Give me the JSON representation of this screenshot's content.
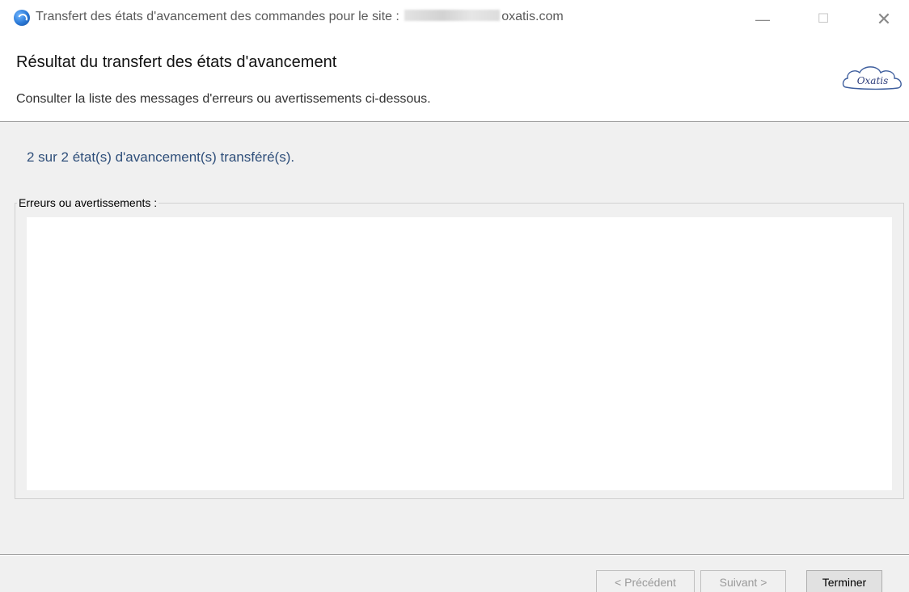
{
  "window": {
    "title_prefix": "Transfert des états d'avancement des commandes pour le site :",
    "title_suffix": "oxatis.com",
    "minimize_glyph": "—",
    "maximize_glyph": "☐",
    "close_glyph": "✕"
  },
  "header": {
    "title": "Résultat du transfert des états d'avancement",
    "subtitle": "Consulter la liste des messages d'erreurs ou avertissements ci-dessous.",
    "logo_text": "Oxatis"
  },
  "body": {
    "summary": "2 sur 2 état(s) d'avancement(s) transféré(s).",
    "group_label": "Erreurs ou avertissements :",
    "messages": ""
  },
  "footer": {
    "prev_label": "< Précédent",
    "next_label": "Suivant >",
    "finish_label": "Terminer"
  },
  "colors": {
    "summary_text": "#2f4f7a",
    "window_bg": "#f0f0f0",
    "header_bg": "#ffffff"
  },
  "icons": {
    "app": "app-icon",
    "logo": "oxatis-cloud-logo"
  }
}
